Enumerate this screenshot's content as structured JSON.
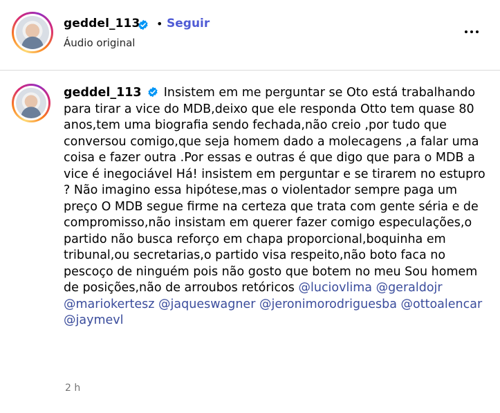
{
  "header": {
    "username": "geddel_113",
    "separator": "•",
    "follow_label": "Seguir",
    "audio_label": "Áudio original",
    "more_icon": "more-horizontal-icon"
  },
  "post": {
    "username": "geddel_113",
    "caption": "Insistem em me perguntar se Oto está trabalhando para tirar a vice do MDB,deixo que ele responda Otto tem quase 80 anos,tem uma biografia sendo fechada,não creio ,por tudo que conversou comigo,que seja homem dado a molecagens ,a falar uma coisa e fazer outra .Por essas e outras é que digo que para o MDB a vice é inegociável Há! insistem em perguntar e se tirarem no estupro ? Não imagino essa hipótese,mas o violentador sempre paga um preço O MDB segue firme na certeza que trata com gente séria e de compromisso,não insistam em querer fazer comigo especulações,o partido não busca reforço em chapa proporcional,boquinha em tribunal,ou secretarias,o partido visa respeito,não boto faca no pescoço de ninguém pois não gosto que botem no meu Sou homem de posições,não de arroubos retóricos",
    "mentions": [
      "@luciovlima",
      "@geraldojr",
      "@mariokertesz",
      "@jaqueswagner",
      "@jeronimorodriguesba",
      "@ottoalencar",
      "@jaymevl"
    ],
    "timestamp": "2 h"
  },
  "colors": {
    "follow": "#4f5bd5",
    "mention": "#3a4c9c",
    "verified": "#0095f6",
    "muted": "#737373"
  }
}
